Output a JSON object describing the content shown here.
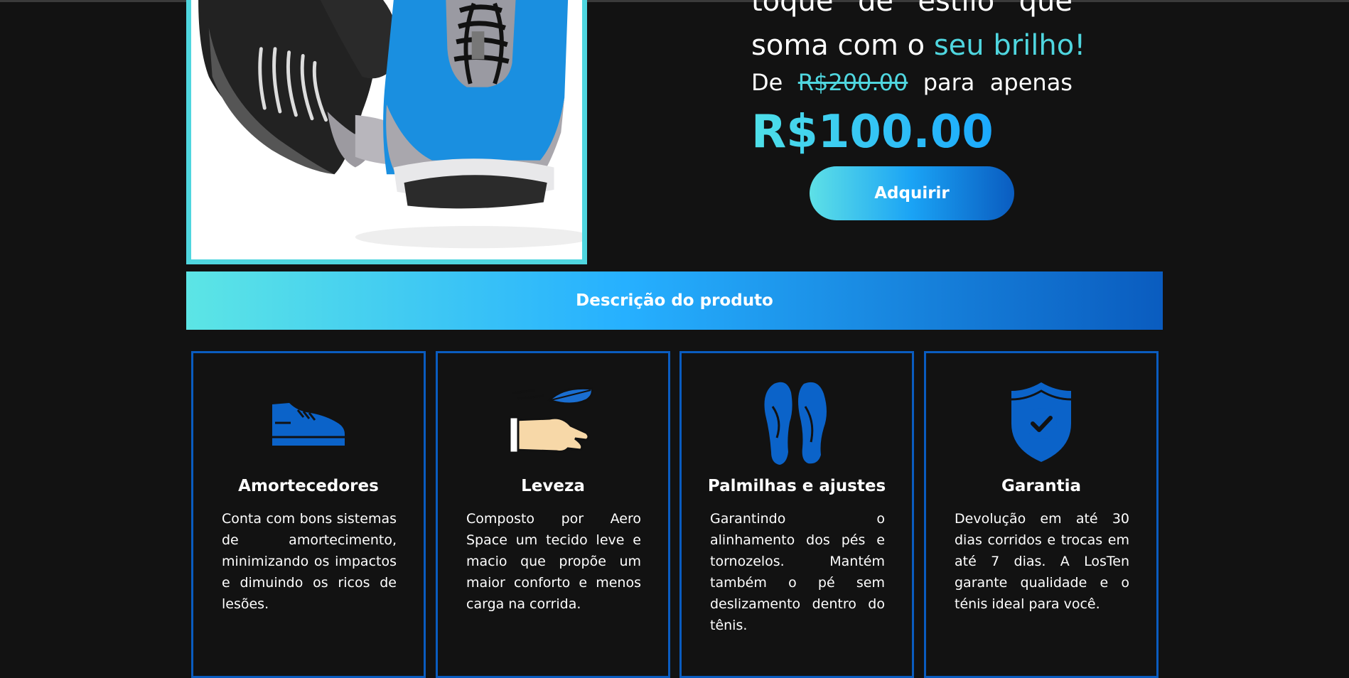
{
  "hero": {
    "line1_words": [
      "toque",
      "de",
      "estilo",
      "que"
    ],
    "line2_prefix": "soma com o",
    "line2_accent": "seu brilho!",
    "price_prefix": "De",
    "old_price": "R$200.00",
    "price_connector": "para",
    "price_suffix": "apenas",
    "new_price": "R$100.00",
    "buy_label": "Adquirir"
  },
  "description": {
    "title": "Descrição do produto"
  },
  "features": [
    {
      "icon": "sneaker-icon",
      "title": "Amortecedores",
      "text": "Conta com bons sistemas de amortecimento, minimizando os impactos e dimuindo os ricos de lesões."
    },
    {
      "icon": "feather-hand-icon",
      "title": "Leveza",
      "text": "Composto por Aero Space um tecido leve e macio que propõe um maior conforto e menos carga na corrida."
    },
    {
      "icon": "insoles-icon",
      "title": "Palmilhas e ajustes",
      "text": "Garantindo o alinhamento dos pés e tornozelos. Mantém também o pé sem deslizamento dentro do tênis."
    },
    {
      "icon": "shield-check-icon",
      "title": "Garantia",
      "text": "Devolução em até 30 dias corridos e trocas em até 7 dias. A LosTen garante qualidade e o ténis ideal para você."
    }
  ],
  "colors": {
    "accent": "#4fd6df",
    "brand_blue": "#0a5cc0",
    "background": "#121212"
  }
}
